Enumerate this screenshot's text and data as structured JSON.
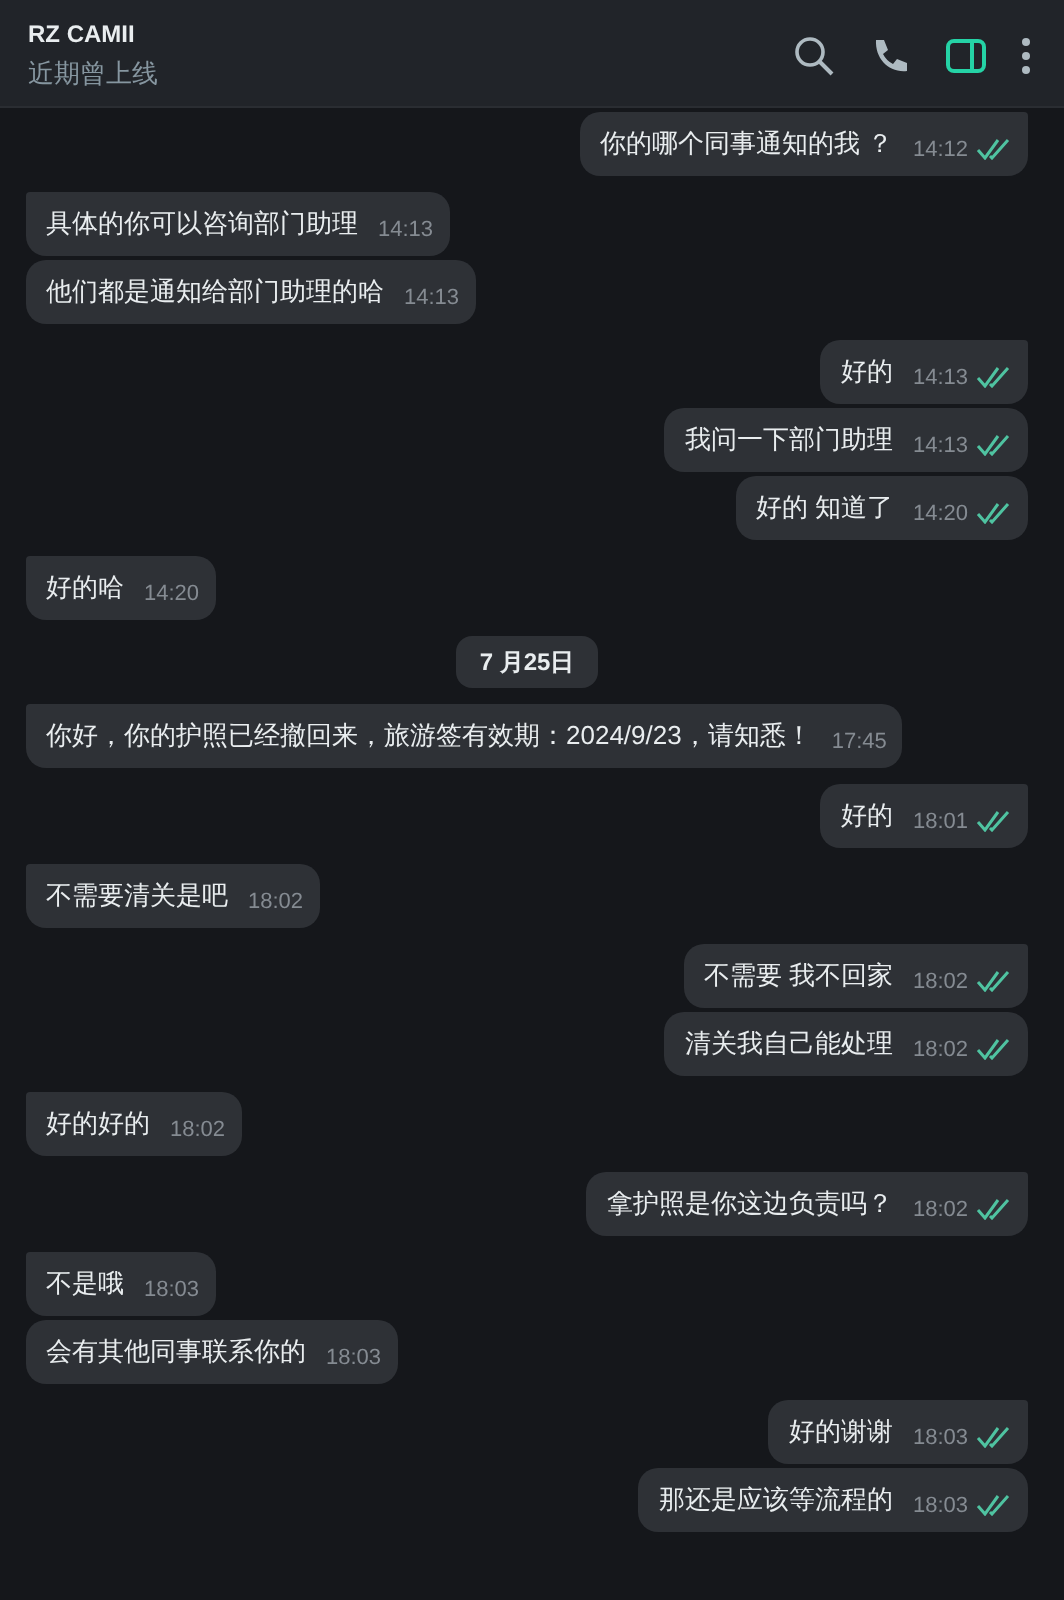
{
  "header": {
    "title": "RZ CAMII",
    "status": "近期曾上线"
  },
  "messages": [
    {
      "kind": "message",
      "outgoing": true,
      "text": "你的哪个同事通知的我 ？",
      "time": "14:12",
      "read": true
    },
    {
      "kind": "message",
      "outgoing": false,
      "text": "具体的你可以咨询部门助理",
      "time": "14:13"
    },
    {
      "kind": "message",
      "outgoing": false,
      "text": "他们都是通知给部门助理的哈",
      "time": "14:13"
    },
    {
      "kind": "message",
      "outgoing": true,
      "text": "好的",
      "time": "14:13",
      "read": true
    },
    {
      "kind": "message",
      "outgoing": true,
      "text": "我问一下部门助理",
      "time": "14:13",
      "read": true
    },
    {
      "kind": "message",
      "outgoing": true,
      "text": "好的 知道了",
      "time": "14:20",
      "read": true
    },
    {
      "kind": "message",
      "outgoing": false,
      "text": "好的哈",
      "time": "14:20"
    },
    {
      "kind": "date",
      "text": "7 月25日"
    },
    {
      "kind": "message",
      "outgoing": false,
      "text": "你好，你的护照已经撤回来，旅游签有效期：2024/9/23，请知悉！",
      "time": "17:45"
    },
    {
      "kind": "message",
      "outgoing": true,
      "text": "好的",
      "time": "18:01",
      "read": true
    },
    {
      "kind": "message",
      "outgoing": false,
      "text": "不需要清关是吧",
      "time": "18:02"
    },
    {
      "kind": "message",
      "outgoing": true,
      "text": "不需要 我不回家",
      "time": "18:02",
      "read": true
    },
    {
      "kind": "message",
      "outgoing": true,
      "text": "清关我自己能处理",
      "time": "18:02",
      "read": true
    },
    {
      "kind": "message",
      "outgoing": false,
      "text": "好的好的",
      "time": "18:02"
    },
    {
      "kind": "message",
      "outgoing": true,
      "text": "拿护照是你这边负责吗？",
      "time": "18:02",
      "read": true
    },
    {
      "kind": "message",
      "outgoing": false,
      "text": "不是哦",
      "time": "18:03"
    },
    {
      "kind": "message",
      "outgoing": false,
      "text": "会有其他同事联系你的",
      "time": "18:03"
    },
    {
      "kind": "message",
      "outgoing": true,
      "text": "好的谢谢",
      "time": "18:03",
      "read": true
    },
    {
      "kind": "message",
      "outgoing": true,
      "text": "那还是应该等流程的",
      "time": "18:03",
      "read": true
    }
  ]
}
